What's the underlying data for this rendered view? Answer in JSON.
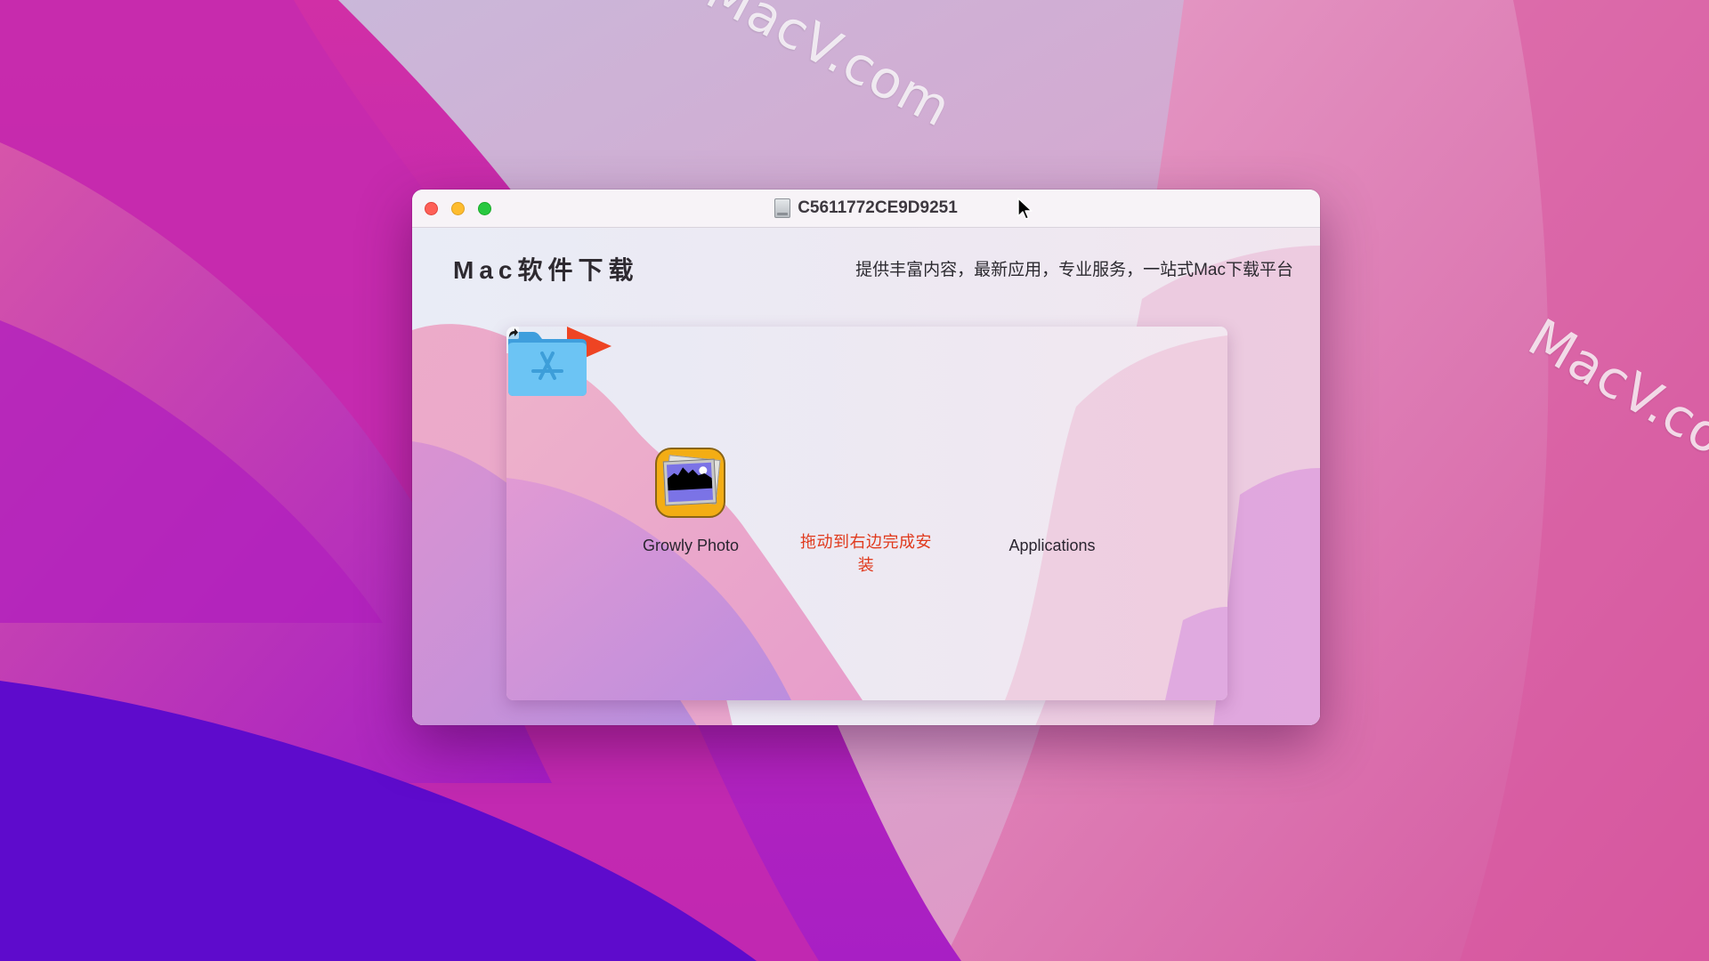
{
  "desktop": {
    "watermark_text": "MacV.com",
    "colors": {
      "deep_violet": "#5e0bcc",
      "magenta": "#c42fb0",
      "pink": "#e07ab8",
      "lavender": "#c9b8dc"
    }
  },
  "window": {
    "title": "C5611772CE9D9251",
    "title_icon": "disk-image-icon",
    "traffic_lights": [
      {
        "name": "close",
        "color": "#fe5f57"
      },
      {
        "name": "minimize",
        "color": "#febc2e"
      },
      {
        "name": "zoom",
        "color": "#28c840"
      }
    ],
    "brand": "Mac软件下载",
    "tagline": "提供丰富内容，最新应用，专业服务，一站式Mac下载平台",
    "installer": {
      "app_name": "Growly Photo",
      "app_icon": "growly-photo-app-icon",
      "instruction": "拖动到右边完成安装",
      "instruction_color": "#e0391c",
      "target_name": "Applications",
      "target_icon": "applications-folder-icon"
    }
  }
}
